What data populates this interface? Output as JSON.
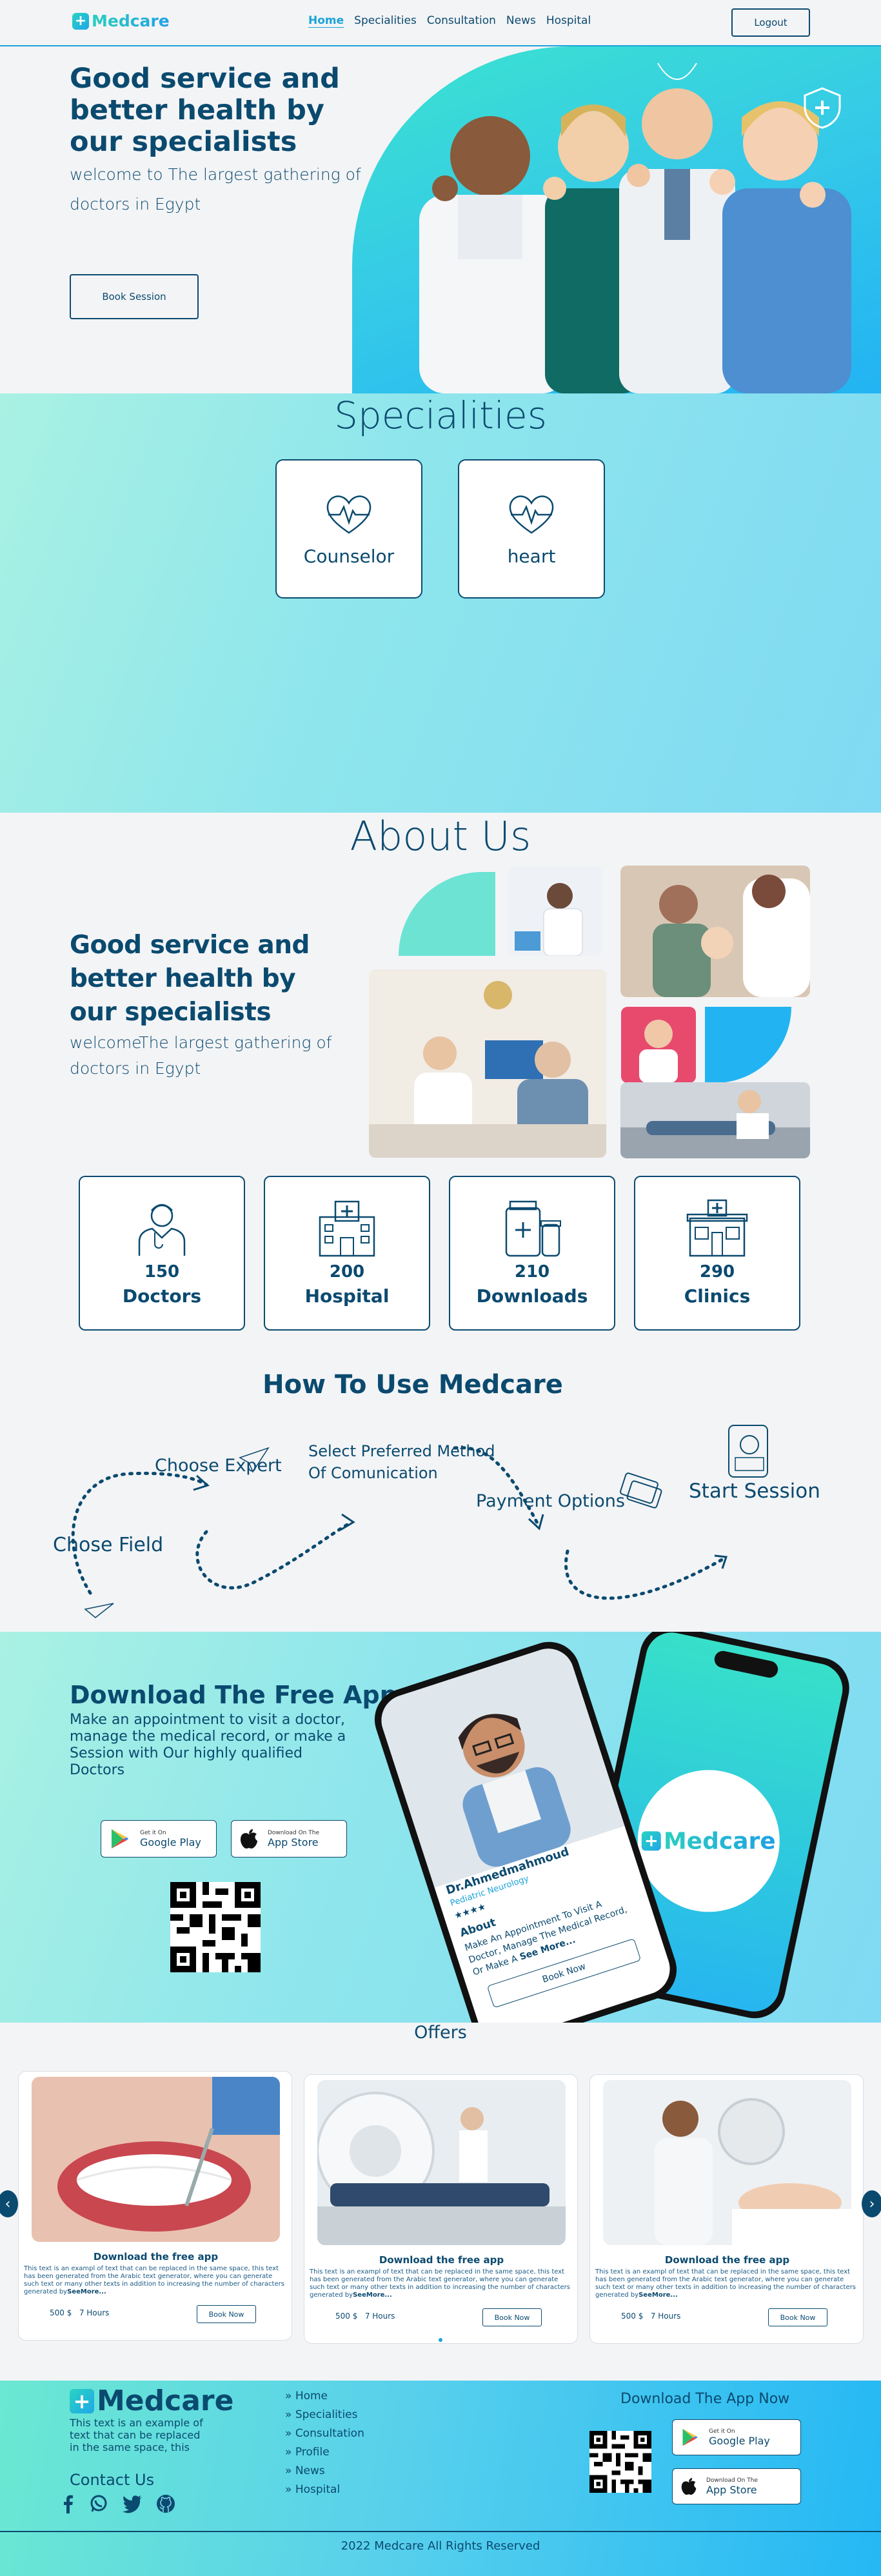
{
  "brand": {
    "name": "Medcare",
    "mark": "+"
  },
  "nav": {
    "links": [
      "Home",
      "Specialities",
      "Consultation",
      "News",
      "Hospital"
    ],
    "logout": "Logout"
  },
  "hero": {
    "title": "Good service and better health by our specialists",
    "subtitle": "welcome to The largest gathering of doctors in Egypt",
    "cta": "Book Session"
  },
  "specialities": {
    "title": "Specialities",
    "items": [
      {
        "label": "Counselor",
        "icon": "heart-pulse-icon"
      },
      {
        "label": "heart",
        "icon": "heart-pulse-icon"
      }
    ]
  },
  "about": {
    "title": "About Us",
    "heading": "Good service and better health by our specialists",
    "text": "welcomeThe largest gathering of doctors in Egypt",
    "stats": [
      {
        "num": "150",
        "label": "Doctors",
        "icon": "doctor-icon"
      },
      {
        "num": "200",
        "label": "Hospital",
        "icon": "hospital-icon"
      },
      {
        "num": "210",
        "label": "Downloads",
        "icon": "medicine-icon"
      },
      {
        "num": "290",
        "label": "Clinics",
        "icon": "clinic-icon"
      }
    ]
  },
  "how": {
    "title": "How To Use Medcare",
    "steps": [
      "Chose Field",
      "Choose Expert",
      "Select Preferred Method Of Comunication",
      "Payment Options",
      "Start Session"
    ]
  },
  "download": {
    "title": "Download The Free App",
    "text": "Make an appointment to visit a doctor, manage the medical record, or make a Session with Our highly qualified Doctors",
    "google": {
      "small": "Get it On",
      "big": "Google Play"
    },
    "apple": {
      "small": "Download On The",
      "big": "App Store"
    },
    "phone": {
      "doctor": "Dr.Ahmedmahmoud",
      "specialty": "Pediatric Neurology",
      "about_title": "About",
      "about": "Make An Appointment To Visit A Doctor, Manage The Medical Record, Or Make A",
      "see_more": "See More...",
      "book": "Book Now"
    },
    "phone2_brand": "Medcare"
  },
  "offers": {
    "title": "Offers",
    "items": [
      {
        "title": "Download the free app",
        "desc": "This text is an exampl of text that can be replaced in the same space, this text has been generated from the Arabic text generator, where you can generate such text or many other texts in addition to increasing the number of characters generated by",
        "more": "SeeMore...",
        "price": "500 $",
        "hours": "7 Hours",
        "book": "Book Now"
      },
      {
        "title": "Download the free app",
        "desc": "This text is an exampl of text that can be replaced in the same space, this text has been generated from the Arabic text generator, where you can generate such text or many other texts in addition to increasing the number of characters generated by",
        "more": "SeeMore...",
        "price": "500 $",
        "hours": "7 Hours",
        "book": "Book Now"
      },
      {
        "title": "Download the free app",
        "desc": "This text is an exampl of text that can be replaced in the same space, this text has been generated from the Arabic text generator, where you can generate such text or many other texts in addition to increasing the number of characters generated by",
        "more": "SeeMore...",
        "price": "500 $",
        "hours": "7 Hours",
        "book": "Book Now"
      }
    ],
    "prev": "‹",
    "next": "›"
  },
  "footer": {
    "text": "This text is an example of text that can be replaced in the same space, this",
    "contact": "Contact Us",
    "links": [
      "Home",
      "Specialities",
      "Consultation",
      "Profile",
      "News",
      "Hospital"
    ],
    "download_title": "Download The App Now",
    "copyright": "2022 Medcare All Rights Reserved"
  },
  "colors": {
    "navy": "#0b4a6f",
    "teal": "#2bcfbf",
    "sky": "#1aa3d9"
  }
}
